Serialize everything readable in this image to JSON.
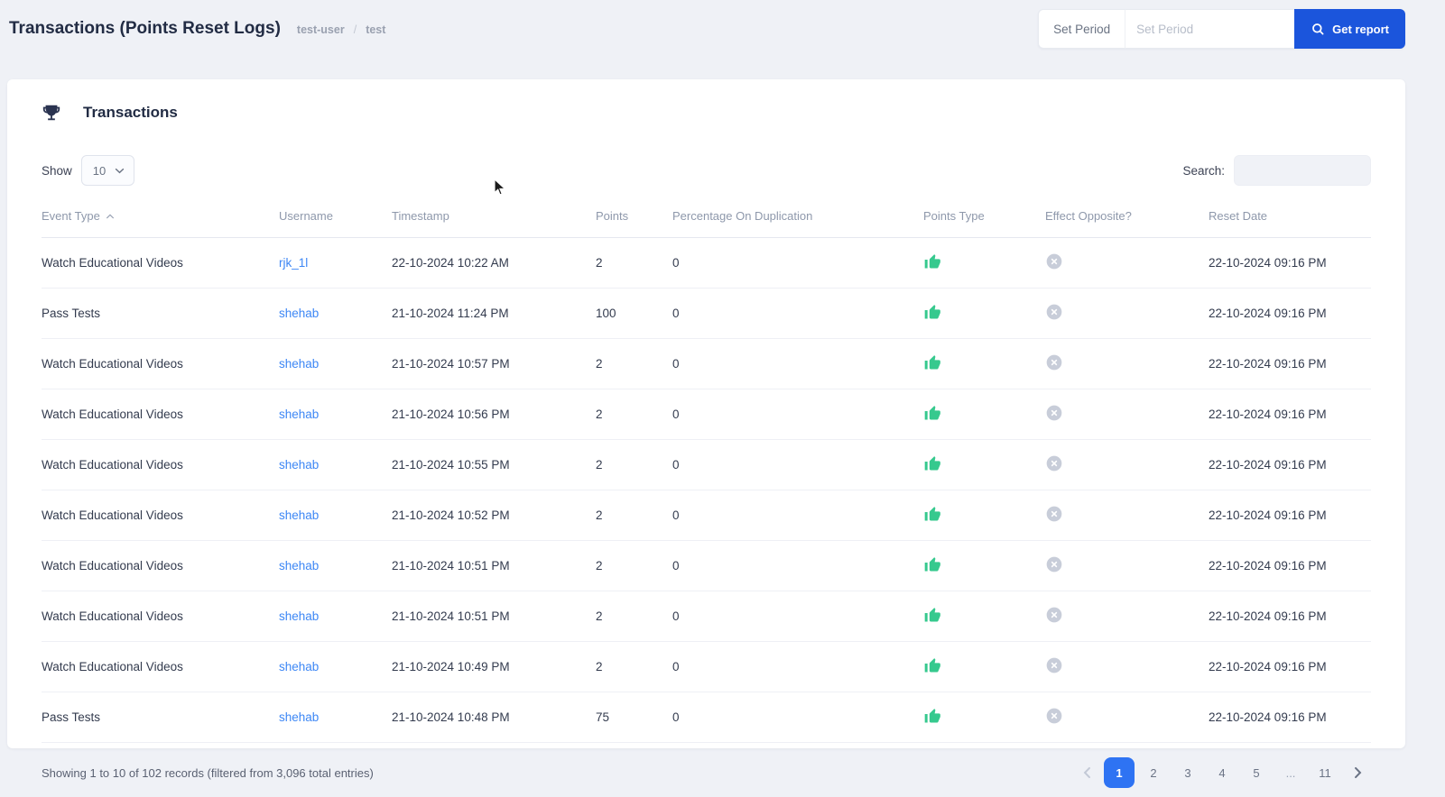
{
  "page": {
    "title": "Transactions (Points Reset Logs)",
    "breadcrumb": [
      "test-user",
      "test"
    ]
  },
  "toolbar": {
    "set_period_label": "Set Period",
    "set_period_placeholder": "Set Period",
    "get_report_label": "Get report"
  },
  "card": {
    "title": "Transactions",
    "show_label": "Show",
    "show_value": "10",
    "search_label": "Search:"
  },
  "table": {
    "columns": [
      "Event Type",
      "Username",
      "Timestamp",
      "Points",
      "Percentage On Duplication",
      "Points Type",
      "Effect Opposite?",
      "Reset Date"
    ],
    "sorted_column": "Event Type",
    "sort_direction": "asc",
    "rows": [
      {
        "event_type": "Watch Educational Videos",
        "username": "rjk_1l",
        "timestamp": "22-10-2024 10:22 AM",
        "points": "2",
        "percentage": "0",
        "points_type": "positive",
        "effect_opposite": "no",
        "reset_date": "22-10-2024 09:16 PM"
      },
      {
        "event_type": "Pass Tests",
        "username": "shehab",
        "timestamp": "21-10-2024 11:24 PM",
        "points": "100",
        "percentage": "0",
        "points_type": "positive",
        "effect_opposite": "no",
        "reset_date": "22-10-2024 09:16 PM"
      },
      {
        "event_type": "Watch Educational Videos",
        "username": "shehab",
        "timestamp": "21-10-2024 10:57 PM",
        "points": "2",
        "percentage": "0",
        "points_type": "positive",
        "effect_opposite": "no",
        "reset_date": "22-10-2024 09:16 PM"
      },
      {
        "event_type": "Watch Educational Videos",
        "username": "shehab",
        "timestamp": "21-10-2024 10:56 PM",
        "points": "2",
        "percentage": "0",
        "points_type": "positive",
        "effect_opposite": "no",
        "reset_date": "22-10-2024 09:16 PM"
      },
      {
        "event_type": "Watch Educational Videos",
        "username": "shehab",
        "timestamp": "21-10-2024 10:55 PM",
        "points": "2",
        "percentage": "0",
        "points_type": "positive",
        "effect_opposite": "no",
        "reset_date": "22-10-2024 09:16 PM"
      },
      {
        "event_type": "Watch Educational Videos",
        "username": "shehab",
        "timestamp": "21-10-2024 10:52 PM",
        "points": "2",
        "percentage": "0",
        "points_type": "positive",
        "effect_opposite": "no",
        "reset_date": "22-10-2024 09:16 PM"
      },
      {
        "event_type": "Watch Educational Videos",
        "username": "shehab",
        "timestamp": "21-10-2024 10:51 PM",
        "points": "2",
        "percentage": "0",
        "points_type": "positive",
        "effect_opposite": "no",
        "reset_date": "22-10-2024 09:16 PM"
      },
      {
        "event_type": "Watch Educational Videos",
        "username": "shehab",
        "timestamp": "21-10-2024 10:51 PM",
        "points": "2",
        "percentage": "0",
        "points_type": "positive",
        "effect_opposite": "no",
        "reset_date": "22-10-2024 09:16 PM"
      },
      {
        "event_type": "Watch Educational Videos",
        "username": "shehab",
        "timestamp": "21-10-2024 10:49 PM",
        "points": "2",
        "percentage": "0",
        "points_type": "positive",
        "effect_opposite": "no",
        "reset_date": "22-10-2024 09:16 PM"
      },
      {
        "event_type": "Pass Tests",
        "username": "shehab",
        "timestamp": "21-10-2024 10:48 PM",
        "points": "75",
        "percentage": "0",
        "points_type": "positive",
        "effect_opposite": "no",
        "reset_date": "22-10-2024 09:16 PM"
      }
    ]
  },
  "footer": {
    "summary": "Showing 1 to 10 of 102 records (filtered from 3,096 total entries)",
    "pages": [
      "1",
      "2",
      "3",
      "4",
      "5",
      "...",
      "11"
    ],
    "active_page": "1"
  },
  "icons": {
    "points_type_positive": "thumbs-up-icon",
    "effect_opposite_no": "x-circle-icon"
  },
  "colors": {
    "accent": "#1b55dc",
    "pagination_active": "#2e73f3",
    "link": "#3d87f5",
    "success": "#36c98e",
    "neutral_icon": "#c8cdd9"
  }
}
